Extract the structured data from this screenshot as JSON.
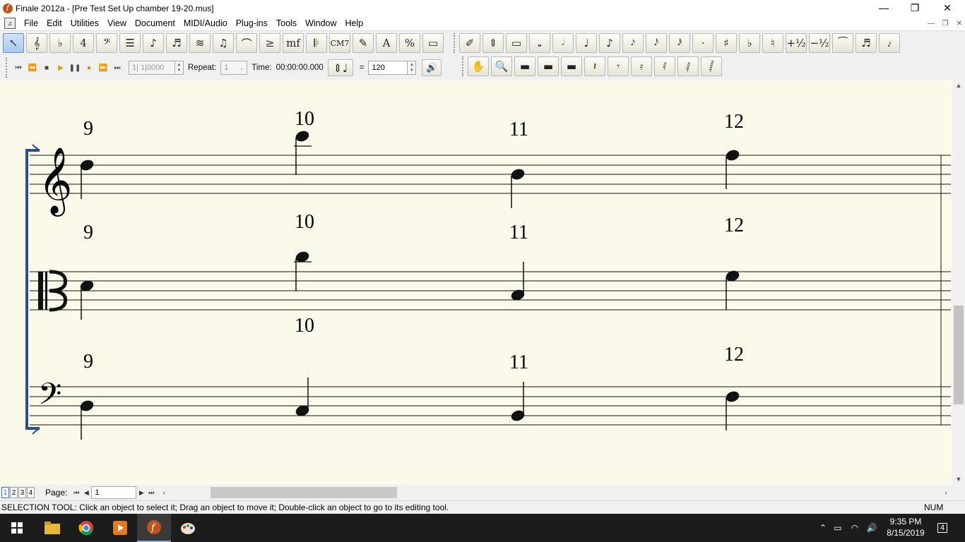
{
  "window": {
    "title": "Finale 2012a - [Pre Test Set Up chamber 19-20.mus]",
    "minimize": "—",
    "restore": "❐",
    "close": "✕"
  },
  "menu": [
    "File",
    "Edit",
    "Utilities",
    "View",
    "Document",
    "MIDI/Audio",
    "Plug-ins",
    "Tools",
    "Window",
    "Help"
  ],
  "toolbar_main": [
    {
      "name": "selection-tool-button",
      "glyph": "↖",
      "active": true
    },
    {
      "name": "staff-tool-button",
      "glyph": "𝄞"
    },
    {
      "name": "key-signature-tool-button",
      "glyph": "♭"
    },
    {
      "name": "time-signature-tool-button",
      "glyph": "4"
    },
    {
      "name": "clef-tool-button",
      "glyph": "𝄢"
    },
    {
      "name": "measure-tool-button",
      "glyph": "☰"
    },
    {
      "name": "simple-entry-tool-button",
      "glyph": "♪"
    },
    {
      "name": "speedy-entry-tool-button",
      "glyph": "♬"
    },
    {
      "name": "hyperscribe-tool-button",
      "glyph": "≋"
    },
    {
      "name": "tuplet-tool-button",
      "glyph": "♫"
    },
    {
      "name": "smart-shape-tool-button",
      "glyph": "⌒"
    },
    {
      "name": "articulation-tool-button",
      "glyph": "≥"
    },
    {
      "name": "expression-tool-button",
      "glyph": "mf"
    },
    {
      "name": "repeat-tool-button",
      "glyph": "𝄆"
    },
    {
      "name": "chord-tool-button",
      "glyph": "CM7"
    },
    {
      "name": "lyrics-tool-button",
      "glyph": "✎"
    },
    {
      "name": "text-tool-button",
      "glyph": "A"
    },
    {
      "name": "resize-tool-button",
      "glyph": "%"
    },
    {
      "name": "page-layout-tool-button",
      "glyph": "▭"
    }
  ],
  "toolbar_simple": [
    {
      "name": "eraser-button",
      "glyph": "✐"
    },
    {
      "name": "tilt-button",
      "glyph": "⇕"
    },
    {
      "name": "breve-button",
      "glyph": "▭"
    },
    {
      "name": "whole-note-button",
      "glyph": "𝅝"
    },
    {
      "name": "half-note-button",
      "glyph": "𝅗𝅥"
    },
    {
      "name": "quarter-note-button",
      "glyph": "♩"
    },
    {
      "name": "eighth-note-button",
      "glyph": "♪"
    },
    {
      "name": "sixteenth-note-button",
      "glyph": "𝅘𝅥𝅯"
    },
    {
      "name": "thirtysecond-note-button",
      "glyph": "𝅘𝅥𝅰"
    },
    {
      "name": "sixtyfourth-note-button",
      "glyph": "𝅘𝅥𝅱"
    },
    {
      "name": "dot-button",
      "glyph": "·"
    },
    {
      "name": "sharp-button",
      "glyph": "♯"
    },
    {
      "name": "flat-button",
      "glyph": "♭"
    },
    {
      "name": "natural-button",
      "glyph": "♮"
    },
    {
      "name": "half-step-up-button",
      "glyph": "+½"
    },
    {
      "name": "half-step-down-button",
      "glyph": "−½"
    },
    {
      "name": "tie-button",
      "glyph": "⁀"
    },
    {
      "name": "tuplet-button",
      "glyph": "♬"
    },
    {
      "name": "grace-note-button",
      "glyph": "𝆔"
    }
  ],
  "playback": {
    "measure_field": "1| 1|0000",
    "repeat_label": "Repeat:",
    "repeat_value": "1",
    "time_label": "Time:",
    "time_value": "00:00:00.000",
    "equals": "=",
    "tempo_value": "120"
  },
  "toolbar_rests": [
    {
      "name": "hand-grabber-button",
      "glyph": "✋"
    },
    {
      "name": "zoom-button",
      "glyph": "🔍"
    },
    {
      "name": "breve-rest-button",
      "glyph": "▬"
    },
    {
      "name": "whole-rest-button",
      "glyph": "▬"
    },
    {
      "name": "half-rest-button",
      "glyph": "▬"
    },
    {
      "name": "quarter-rest-button",
      "glyph": "𝄽"
    },
    {
      "name": "eighth-rest-button",
      "glyph": "𝄾"
    },
    {
      "name": "sixteenth-rest-button",
      "glyph": "𝄿"
    },
    {
      "name": "thirtysecond-rest-button",
      "glyph": "𝅀"
    },
    {
      "name": "sixtyfourth-rest-button",
      "glyph": "𝅁"
    },
    {
      "name": "onetwentyeighth-rest-button",
      "glyph": "𝅂"
    }
  ],
  "score": {
    "systems": [
      {
        "clef": "treble",
        "measures": [
          "9",
          "10",
          "11",
          "12"
        ]
      },
      {
        "clef": "alto",
        "measures": [
          "9",
          "10",
          "11",
          "12"
        ]
      },
      {
        "clef": "bass",
        "measures": [
          "9",
          "10",
          "11",
          "12"
        ]
      }
    ]
  },
  "pagebar": {
    "page_tabs": [
      "1",
      "2",
      "3",
      "4"
    ],
    "page_label": "Page:",
    "page_value": "1"
  },
  "status": {
    "message": "SELECTION TOOL: Click an object to select it; Drag an object to move it; Double-click an object to go to its editing tool.",
    "num": "NUM"
  },
  "taskbar": {
    "time": "9:35 PM",
    "date": "8/15/2019",
    "notifications": "4"
  }
}
